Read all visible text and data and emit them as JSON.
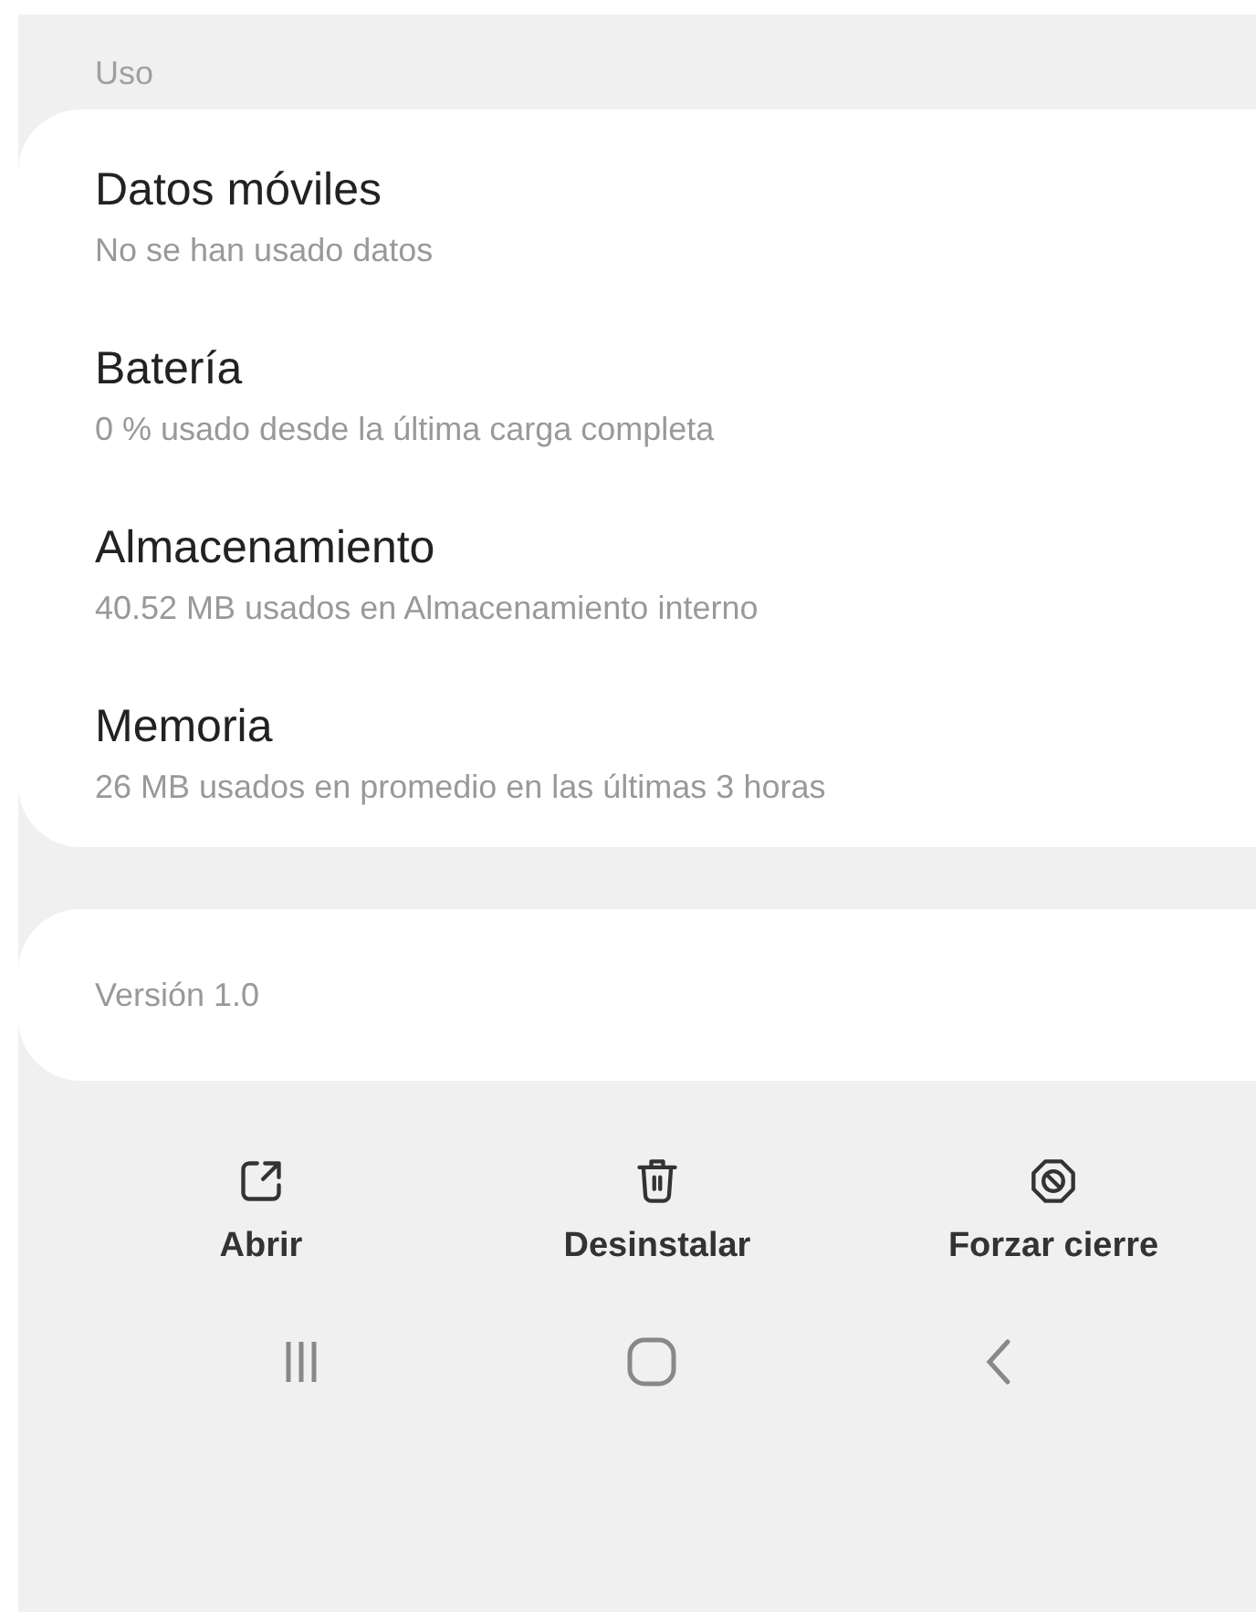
{
  "section_header": "Uso",
  "usage_items": [
    {
      "title": "Datos móviles",
      "subtitle": "No se han usado datos"
    },
    {
      "title": "Batería",
      "subtitle": "0 % usado desde la última carga completa"
    },
    {
      "title": "Almacenamiento",
      "subtitle": "40.52 MB usados en Almacenamiento interno"
    },
    {
      "title": "Memoria",
      "subtitle": "26 MB usados en promedio en las últimas 3 horas"
    }
  ],
  "version": "Versión 1.0",
  "actions": [
    {
      "kind": "open",
      "label": "Abrir"
    },
    {
      "kind": "uninstall",
      "label": "Desinstalar"
    },
    {
      "kind": "force_stop",
      "label": "Forzar cierre"
    }
  ]
}
